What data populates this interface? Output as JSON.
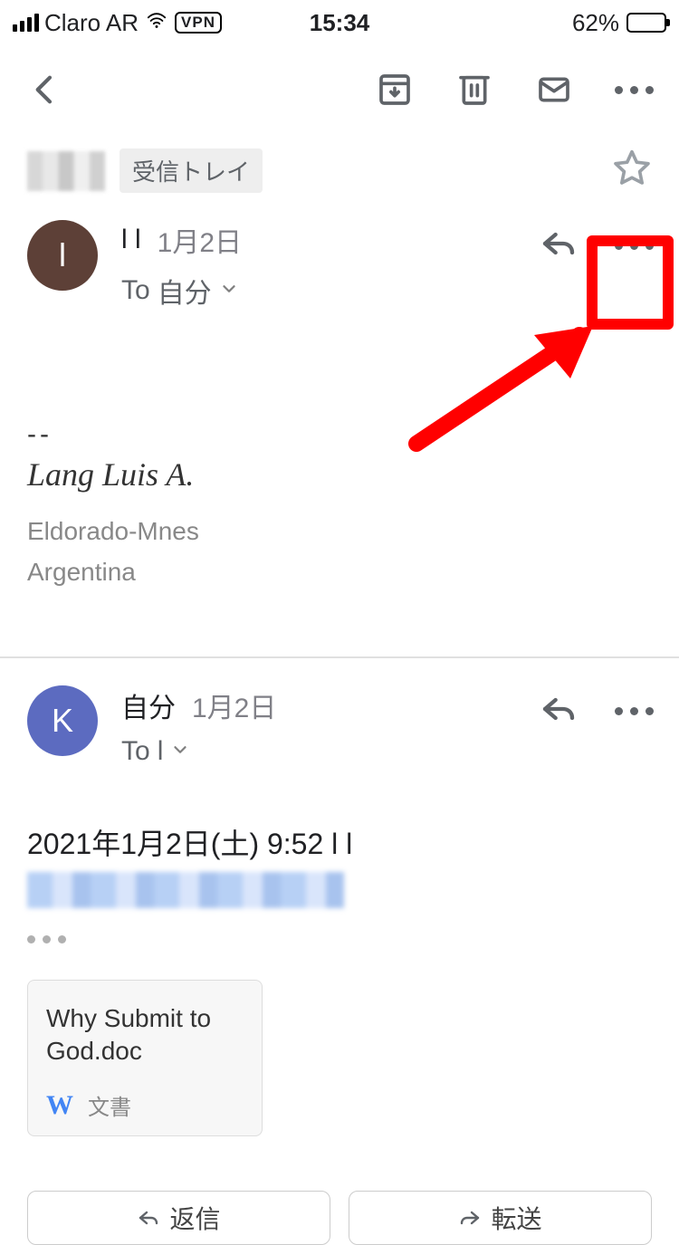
{
  "status": {
    "carrier": "Claro AR",
    "vpn": "VPN",
    "time": "15:34",
    "battery_pct": "62%"
  },
  "subject": {
    "inbox_chip": "受信トレイ"
  },
  "msg1": {
    "sender": "l l",
    "date": "1月2日",
    "to_prefix": "To",
    "to_value": "自分",
    "sig_sep": "--",
    "sig_name": "Lang Luis A.",
    "sig_loc1": "Eldorado-Mnes",
    "sig_loc2": "Argentina",
    "avatar_initial": "l"
  },
  "msg2": {
    "sender": "自分",
    "date": "1月2日",
    "to_prefix": "To",
    "to_value": "l",
    "avatar_initial": "K",
    "quoted_header": "2021年1月2日(土) 9:52 l l"
  },
  "attachment": {
    "filename": "Why Submit to God.doc",
    "type_label": "文書"
  },
  "bottom": {
    "reply": "返信",
    "forward": "転送"
  }
}
